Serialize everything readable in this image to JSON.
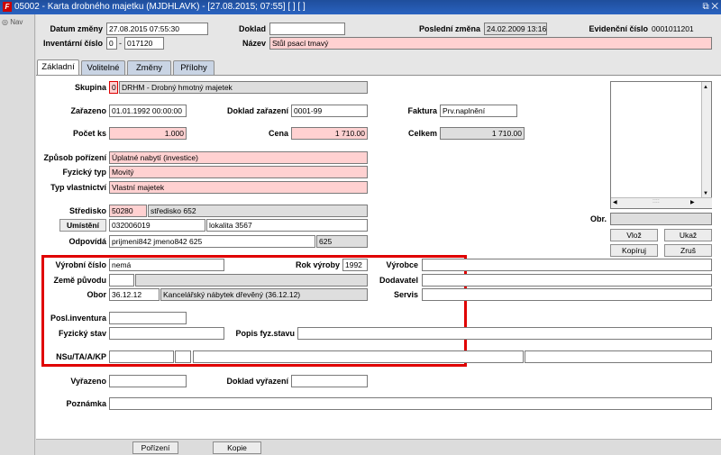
{
  "window": {
    "title": "05002 - Karta drobného majetku (MJDHLAVK) - [27.08.2015; 07:55] [ ] [ ]",
    "logo": "F",
    "controls": "⧉ ✕",
    "nav_label": "◎ Nav"
  },
  "header": {
    "datum_zmeny_label": "Datum změny",
    "datum_zmeny_value": "27.08.2015 07:55:30",
    "doklad_label": "Doklad",
    "doklad_value": "",
    "posledni_zmena_label": "Poslední změna",
    "posledni_zmena_value": "24.02.2009 13:16",
    "evidencni_cislo_label": "Evidenční číslo",
    "evidencni_cislo_value": "0001011201",
    "inventarni_cislo_label": "Inventární číslo",
    "inventarni_cislo_a": "0",
    "inventarni_cislo_b": "017120",
    "nazev_label": "Název",
    "nazev_value": "Stůl psací tmavý"
  },
  "tabs": [
    "Základní",
    "Volitelné",
    "Změny",
    "Přílohy"
  ],
  "form": {
    "skupina_label": "Skupina",
    "skupina_code": "0",
    "skupina_value": "DRHM - Drobný hmotný majetek",
    "zarazeno_label": "Zařazeno",
    "zarazeno_value": "01.01.1992 00:00:00",
    "doklad_zarazeni_label": "Doklad zařazení",
    "doklad_zarazeni_value": "0001-99",
    "faktura_label": "Faktura",
    "faktura_value": "Prv.naplnění",
    "pocet_ks_label": "Počet ks",
    "pocet_ks_value": "1.000",
    "cena_label": "Cena",
    "cena_value": "1 710.00",
    "celkem_label": "Celkem",
    "celkem_value": "1 710.00",
    "zpusob_porizeni_label": "Způsob pořízení",
    "zpusob_porizeni_value": "Úplatné nabytí (investice)",
    "fyzicky_typ_label": "Fyzický typ",
    "fyzicky_typ_value": "Movitý",
    "typ_vlastnictvi_label": "Typ vlastnictví",
    "typ_vlastnictvi_value": "Vlastní majetek",
    "stredisko_label": "Středisko",
    "stredisko_code": "50280",
    "stredisko_name": "středisko 652",
    "umisteni_button": "Umístění",
    "umisteni_code": "032006019",
    "umisteni_name": "lokalita 3567",
    "odpovida_label": "Odpovídá",
    "odpovida_value": "prijmeni842 jmeno842 625",
    "odpovida_code": "625",
    "vyrobni_cislo_label": "Výrobní číslo",
    "vyrobni_cislo_value": "nemá",
    "rok_vyroby_label": "Rok výroby",
    "rok_vyroby_value": "1992",
    "vyrobce_label": "Výrobce",
    "vyrobce_value": "",
    "zeme_puvodu_label": "Země původu",
    "dodavatel_label": "Dodavatel",
    "obor_label": "Obor",
    "obor_code": "36.12.12",
    "obor_name": "Kancelářský nábytek dřevěný (36.12.12)",
    "servis_label": "Servis",
    "posl_inventura_label": "Posl.inventura",
    "fyzicky_stav_label": "Fyzický stav",
    "popis_fyz_stavu_label": "Popis fyz.stavu",
    "nsu_label": "NSu/TA/A/KP",
    "vyrazeno_label": "Vyřazeno",
    "doklad_vyrazeni_label": "Doklad vyřazení",
    "poznamka_label": "Poznámka"
  },
  "side": {
    "obr_label": "Obr.",
    "vloz": "Vlož",
    "ukaz": "Ukaž",
    "kopiruj": "Kopíruj",
    "zrus": "Zruš",
    "scroll_dots": "::::"
  },
  "footer": {
    "porizeni": "Pořízení",
    "kopie": "Kopie"
  }
}
